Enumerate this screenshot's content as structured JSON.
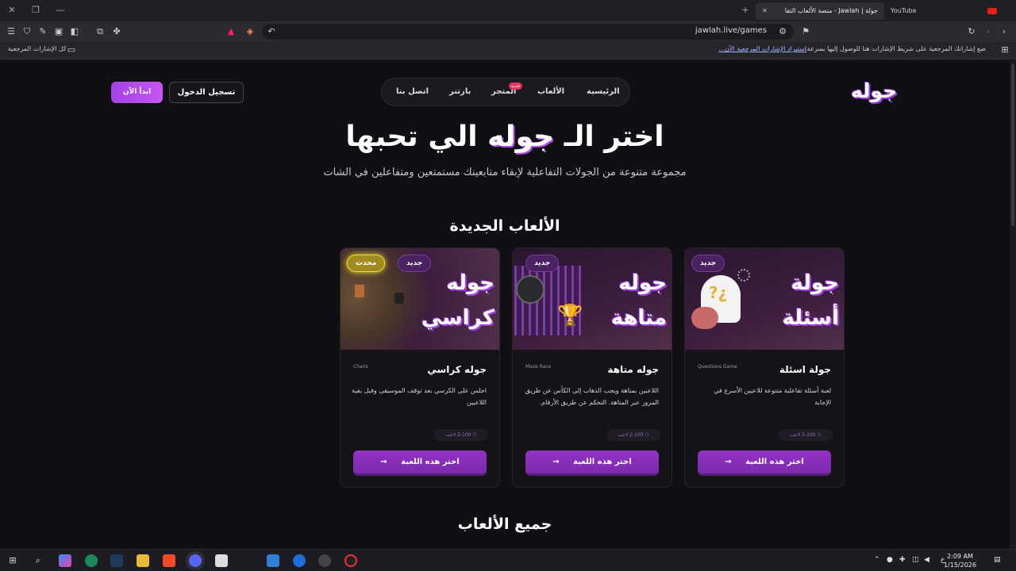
{
  "browser": {
    "tab_active": "جولة | Jawlah - منصة الألعاب التفا",
    "tab_youtube": "YouTube",
    "url": "jawlah.live/games",
    "bookmarks_hint": "ضع إشاراتك المرجعية على شريط الإشارات هنا للوصول إليها بسرعة.",
    "bookmarks_import": "استيراد الإشارات المرجعية الآن...",
    "bookmarks_all": "كل الإشارات المرجعية"
  },
  "header": {
    "logo": "جوله",
    "nav": [
      {
        "label": "الرئيسية"
      },
      {
        "label": "الألعاب"
      },
      {
        "label": "المتجر"
      },
      {
        "label": "بارتنر"
      },
      {
        "label": "اتصل بنا"
      }
    ],
    "new_badge": "جديد",
    "login": "تسجيل الدخول",
    "start": "ابدأ الآن"
  },
  "hero": {
    "title_before": "اختر الـ",
    "title_highlight": "جوله",
    "title_after": "الي تحبها",
    "subtitle": "مجموعة متنوعة من الجولات التفاعلية لإبقاء متابعينك مستمتعين ومتفاعلين في الشات"
  },
  "new_games_title": "الألعاب الجديدة",
  "cards": [
    {
      "thumb_title": "جولة أسئلة",
      "tags": [
        "جديد"
      ],
      "name": "جولة اسئلة",
      "sub": "Questions Game",
      "desc": "لعبة أسئلة تفاعلية متنوعة للاعبين الأسرع في الإجابة",
      "players": "2-100 لاعب",
      "button": "اختر هذه اللعبة"
    },
    {
      "thumb_title": "جوله متاهة",
      "tags": [
        "جديد"
      ],
      "name": "جوله متاهة",
      "sub": "Maze Race",
      "desc": "اللاعبين بمتاهة ويجب الذهاب إلى الكأس عن طريق المرور عبر المتاهة. التحكم عن طريق الأرقام.",
      "players": "2-100 لاعب",
      "button": "اختر هذه اللعبة"
    },
    {
      "thumb_title": "جوله كراسي",
      "tags": [
        "جديد",
        "محدث"
      ],
      "name": "جوله كراسي",
      "sub": "Chairs",
      "desc": "اجلس على الكرسي بعد توقف الموسيقى وقبل بقية اللاعبين",
      "players": "2-100 لاعب",
      "button": "اختر هذه اللعبة"
    }
  ],
  "all_games_title": "جميع الألعاب",
  "taskbar": {
    "time": "2:09 AM",
    "date": "1/15/2026",
    "lang": "ع"
  }
}
